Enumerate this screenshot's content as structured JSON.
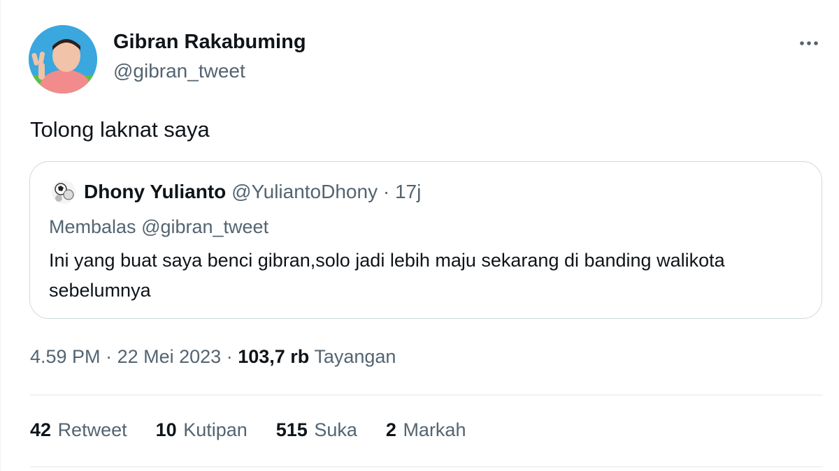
{
  "tweet": {
    "author": {
      "name": "Gibran Rakabuming",
      "handle": "@gibran_tweet"
    },
    "more_icon": "more-horizontal-icon",
    "text": "Tolong laknat saya",
    "quote": {
      "author_name": "Dhony Yulianto",
      "author_handle": "@YuliantoDhony",
      "separator": "·",
      "time": "17j",
      "reply_prefix": "Membalas",
      "reply_to": "@gibran_tweet",
      "text": "Ini yang buat saya benci gibran,solo jadi lebih maju sekarang di banding walikota sebelumnya"
    },
    "meta": {
      "time": "4.59 PM",
      "separator": "·",
      "date": "22 Mei 2023",
      "views_count": "103,7 rb",
      "views_label": "Tayangan"
    },
    "stats": [
      {
        "count": "42",
        "label": "Retweet"
      },
      {
        "count": "10",
        "label": "Kutipan"
      },
      {
        "count": "515",
        "label": "Suka"
      },
      {
        "count": "2",
        "label": "Markah"
      }
    ]
  },
  "colors": {
    "primary_text": "#0f1419",
    "secondary_text": "#536471",
    "border": "#cfd9de",
    "divider": "#eff3f4"
  }
}
